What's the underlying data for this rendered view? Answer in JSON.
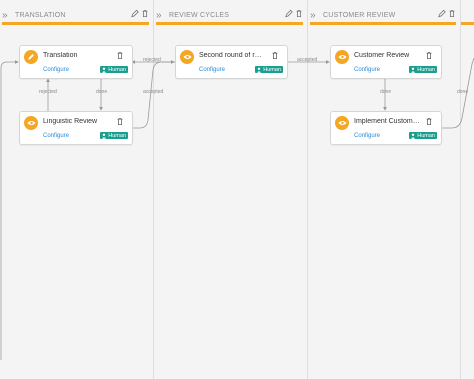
{
  "colors": {
    "accent": "#f5a623",
    "human_badge": "#1b9e8e",
    "link": "#2a8bd8"
  },
  "lanes": [
    {
      "title": "TRANSLATION"
    },
    {
      "title": "REVIEW CYCLES"
    },
    {
      "title": "CUSTOMER REVIEW"
    }
  ],
  "cards": [
    {
      "title": "Translation",
      "configure": "Configure",
      "badge": "Human",
      "icon": "pencil-icon"
    },
    {
      "title": "Linguistic Review",
      "configure": "Configure",
      "badge": "Human",
      "icon": "eye-icon"
    },
    {
      "title": "Second round of review",
      "configure": "Configure",
      "badge": "Human",
      "icon": "eye-icon"
    },
    {
      "title": "Customer Review",
      "configure": "Configure",
      "badge": "Human",
      "icon": "eye-icon"
    },
    {
      "title": "Implement Customer Rev...",
      "configure": "Configure",
      "badge": "Human",
      "icon": "eye-icon"
    }
  ],
  "edge_labels": {
    "rejected_1": "rejected",
    "done_1": "done",
    "rejected_2": "rejected",
    "accepted_1": "accepted",
    "accepted_2": "accepted",
    "done_2": "done",
    "done_3": "done"
  }
}
